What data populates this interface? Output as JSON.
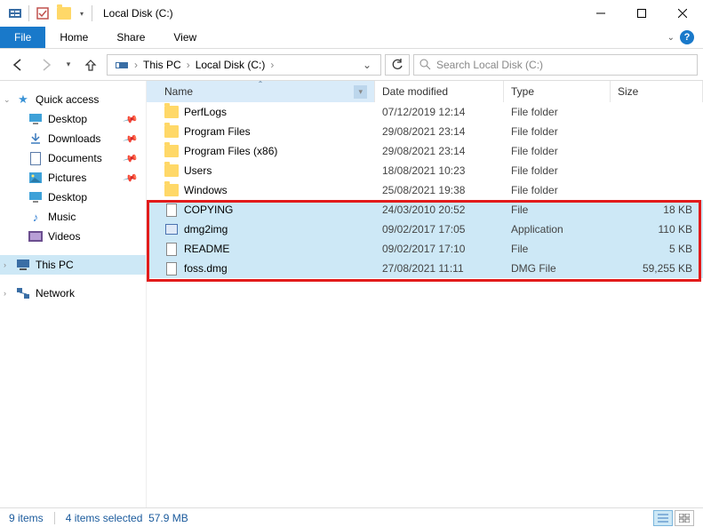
{
  "window": {
    "title": "Local Disk (C:)"
  },
  "ribbon": {
    "file": "File",
    "home": "Home",
    "share": "Share",
    "view": "View"
  },
  "address": {
    "root": "This PC",
    "current": "Local Disk (C:)"
  },
  "search": {
    "placeholder": "Search Local Disk (C:)"
  },
  "sidebar": {
    "quick_access": "Quick access",
    "desktop": "Desktop",
    "downloads": "Downloads",
    "documents": "Documents",
    "pictures": "Pictures",
    "desktop2": "Desktop",
    "music": "Music",
    "videos": "Videos",
    "this_pc": "This PC",
    "network": "Network"
  },
  "columns": {
    "name": "Name",
    "date": "Date modified",
    "type": "Type",
    "size": "Size"
  },
  "rows": [
    {
      "name": "PerfLogs",
      "date": "07/12/2019 12:14",
      "type": "File folder",
      "size": "",
      "icon": "folder",
      "selected": false
    },
    {
      "name": "Program Files",
      "date": "29/08/2021 23:14",
      "type": "File folder",
      "size": "",
      "icon": "folder",
      "selected": false
    },
    {
      "name": "Program Files (x86)",
      "date": "29/08/2021 23:14",
      "type": "File folder",
      "size": "",
      "icon": "folder",
      "selected": false
    },
    {
      "name": "Users",
      "date": "18/08/2021 10:23",
      "type": "File folder",
      "size": "",
      "icon": "folder",
      "selected": false
    },
    {
      "name": "Windows",
      "date": "25/08/2021 19:38",
      "type": "File folder",
      "size": "",
      "icon": "folder",
      "selected": false
    },
    {
      "name": "COPYING",
      "date": "24/03/2010 20:52",
      "type": "File",
      "size": "18 KB",
      "icon": "doc",
      "selected": true
    },
    {
      "name": "dmg2img",
      "date": "09/02/2017 17:05",
      "type": "Application",
      "size": "110 KB",
      "icon": "app",
      "selected": true
    },
    {
      "name": "README",
      "date": "09/02/2017 17:10",
      "type": "File",
      "size": "5 KB",
      "icon": "doc",
      "selected": true
    },
    {
      "name": "foss.dmg",
      "date": "27/08/2021 11:11",
      "type": "DMG File",
      "size": "59,255 KB",
      "icon": "doc",
      "selected": true
    }
  ],
  "status": {
    "count": "9 items",
    "selection": "4 items selected",
    "size": "57.9 MB"
  }
}
